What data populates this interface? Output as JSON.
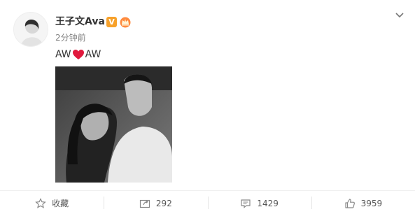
{
  "post": {
    "author": "王子文Ava",
    "verified_badge": "V",
    "time": "2分钟前",
    "text_left": "AW",
    "text_right": "AW"
  },
  "actions": {
    "favorite_label": "收藏",
    "repost_count": "292",
    "comment_count": "1429",
    "like_count": "3959"
  },
  "colors": {
    "badge": "#f7a12a",
    "heart": "#e0193c",
    "muted_text": "#808080"
  },
  "icons": [
    "star-icon",
    "repost-icon",
    "comment-icon",
    "like-icon",
    "chevron-down-icon",
    "crown-icon",
    "heart-icon"
  ]
}
